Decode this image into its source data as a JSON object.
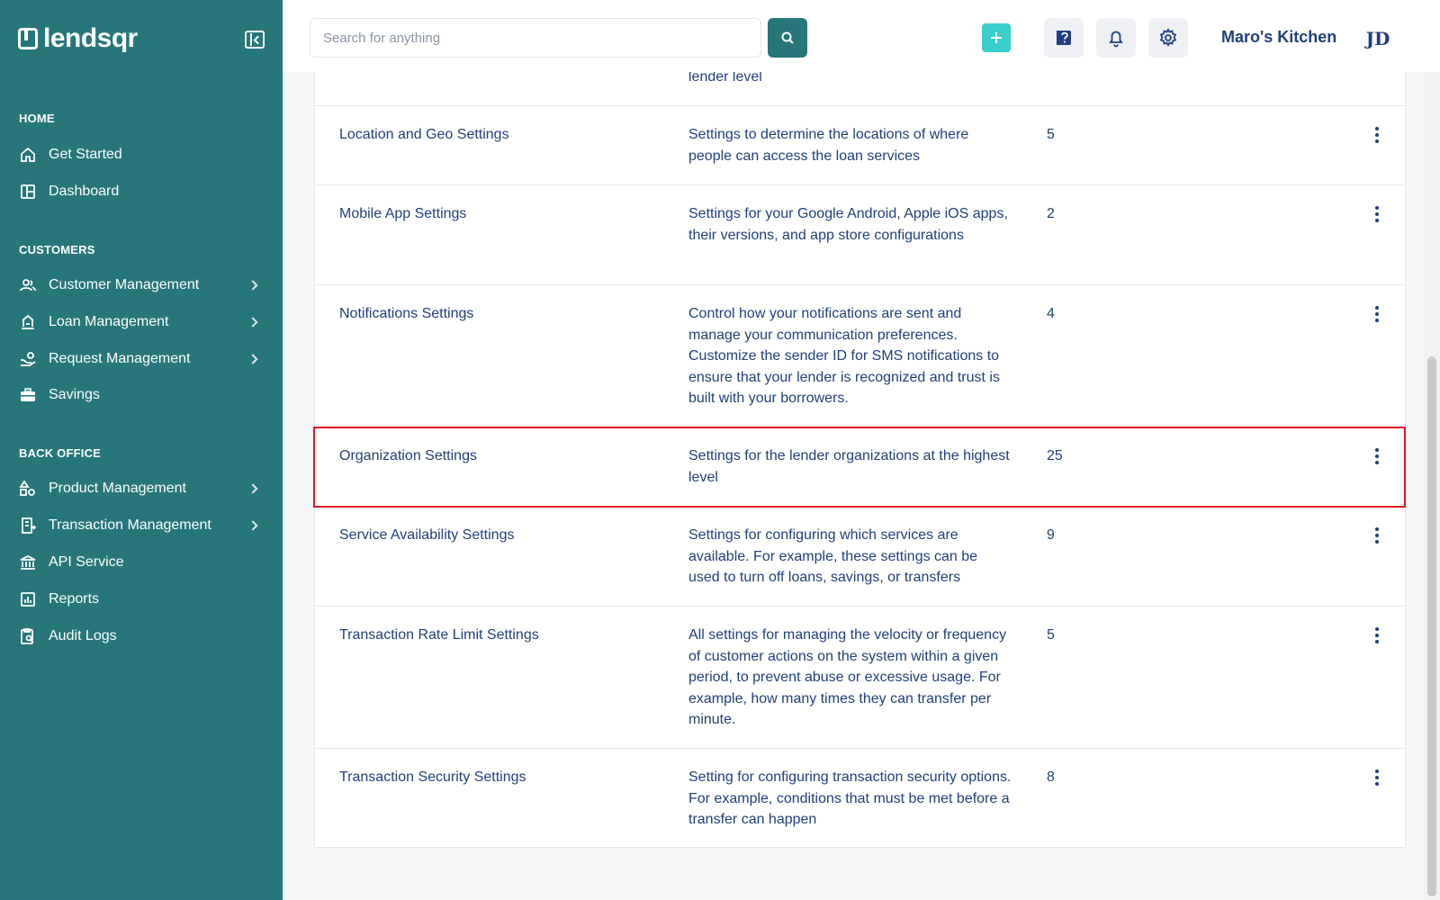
{
  "brand": {
    "name": "lendsqr"
  },
  "sidebar": {
    "sections": [
      {
        "label": "HOME",
        "items": [
          {
            "label": "Get Started",
            "icon": "home-icon",
            "chevron": false
          },
          {
            "label": "Dashboard",
            "icon": "dashboard-icon",
            "chevron": false
          }
        ]
      },
      {
        "label": "CUSTOMERS",
        "items": [
          {
            "label": "Customer Management",
            "icon": "users-icon",
            "chevron": true
          },
          {
            "label": "Loan Management",
            "icon": "loan-icon",
            "chevron": true
          },
          {
            "label": "Request Management",
            "icon": "request-icon",
            "chevron": true
          },
          {
            "label": "Savings",
            "icon": "savings-icon",
            "chevron": false
          }
        ]
      },
      {
        "label": "BACK OFFICE",
        "items": [
          {
            "label": "Product Management",
            "icon": "product-icon",
            "chevron": true
          },
          {
            "label": "Transaction Management",
            "icon": "transaction-icon",
            "chevron": true
          },
          {
            "label": "API Service",
            "icon": "bank-icon",
            "chevron": false
          },
          {
            "label": "Reports",
            "icon": "reports-icon",
            "chevron": false
          },
          {
            "label": "Audit Logs",
            "icon": "audit-icon",
            "chevron": false
          }
        ]
      }
    ]
  },
  "topbar": {
    "search_placeholder": "Search for anything",
    "search_value": "",
    "org_name": "Maro's Kitchen",
    "avatar_initials": "JD"
  },
  "settings": {
    "partial_row": {
      "description_tail": "lender level"
    },
    "rows": [
      {
        "name": "Location and Geo Settings",
        "description": "Settings to determine the locations of where people can access the loan services",
        "count": "5"
      },
      {
        "name": "Mobile App Settings",
        "description": "Settings for your Google Android, Apple iOS apps, their versions, and app store configurations",
        "count": "2"
      },
      {
        "name": "Notifications Settings",
        "description": "Control how your notifications are sent and manage your communication preferences. Customize the sender ID for SMS notifications to ensure that your lender is recognized and trust is built with your borrowers.",
        "count": "4"
      },
      {
        "name": "Organization Settings",
        "description": "Settings for the lender organizations at the highest level",
        "count": "25",
        "highlighted": true
      },
      {
        "name": "Service Availability Settings",
        "description": "Settings for configuring which services are available. For example, these settings can be used to turn off loans, savings, or transfers",
        "count": "9"
      },
      {
        "name": "Transaction Rate Limit Settings",
        "description": "All settings for managing the velocity or frequency of customer actions on the system within a given period, to prevent abuse or excessive usage. For example, how many times they can transfer per minute.",
        "count": "5"
      },
      {
        "name": "Transaction Security Settings",
        "description": "Setting for configuring transaction security options. For example, conditions that must be met before a transfer can happen",
        "count": "8"
      }
    ]
  },
  "colors": {
    "sidebar": "#26767a",
    "accent": "#39cdcc",
    "text": "#213f7d",
    "highlight_border": "#e0161c"
  }
}
